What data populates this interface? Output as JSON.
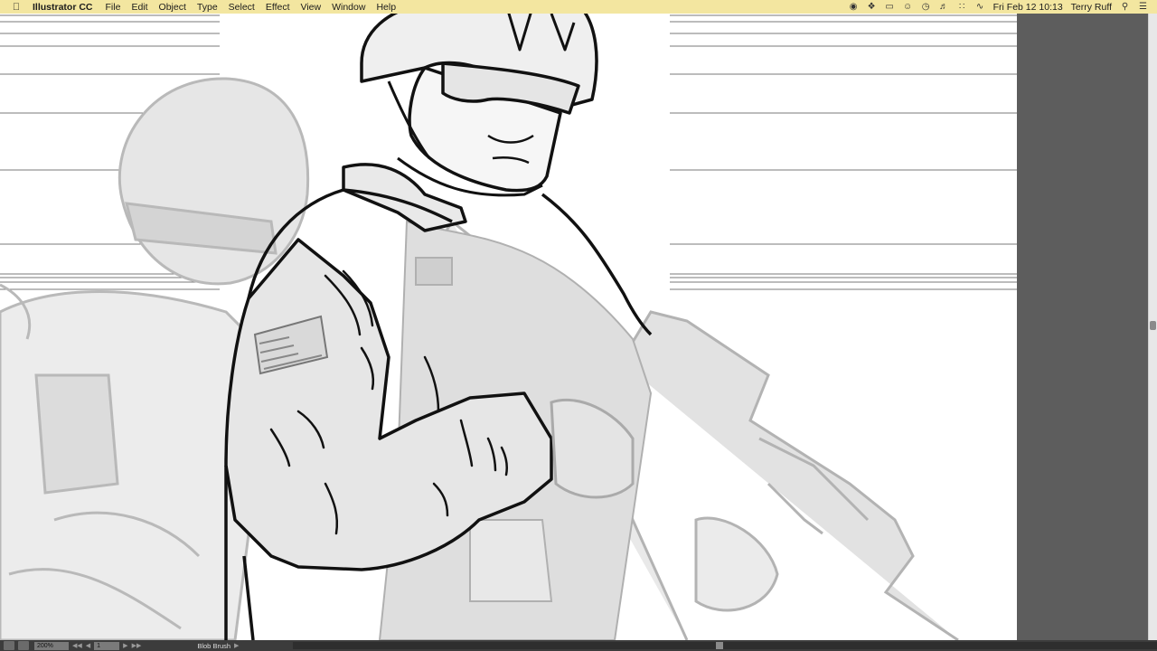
{
  "menubar": {
    "app_name": "Illustrator CC",
    "menus": [
      "File",
      "Edit",
      "Object",
      "Type",
      "Select",
      "Effect",
      "View",
      "Window",
      "Help"
    ],
    "clock": "Fri Feb 12  10:13",
    "user": "Terry Ruff",
    "status_icons": [
      "record-icon",
      "dropbox-icon",
      "display-icon",
      "accessibility-icon",
      "time-machine-icon",
      "volume-icon",
      "bluetooth-icon",
      "wifi-icon"
    ]
  },
  "statusbar": {
    "zoom": "200%",
    "page": "1",
    "tool": "Blob Brush"
  },
  "colors": {
    "menubar_bg": "#f3e6a0",
    "pasteboard": "#5d5d5d",
    "ink": "#111111",
    "sketch": "#b5b5b5",
    "shade": "#d8d8d8"
  }
}
